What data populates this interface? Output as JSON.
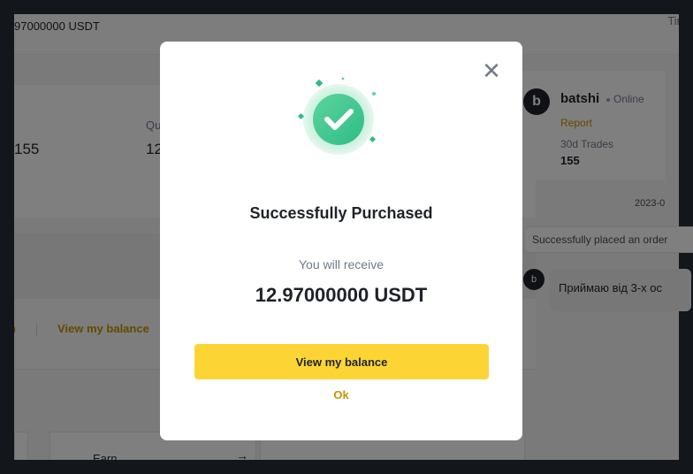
{
  "background": {
    "topbar": {
      "amount": "97000000 USDT",
      "time_label": "Tir"
    },
    "stats": {
      "value_left": "155",
      "quantity_label": "Qu",
      "quantity_value": "12"
    },
    "links": {
      "left_link": "n",
      "view_balance": "View my balance"
    },
    "earn": {
      "label": "Earn",
      "arrow": "→"
    },
    "profile": {
      "avatar_letter": "b",
      "name": "batshi",
      "status": "Online",
      "report": "Report",
      "trades_label": "30d Trades",
      "trades_value": "155"
    },
    "chat": {
      "date": "2023-0",
      "system_message": "Successfully placed an order",
      "avatar_letter": "b",
      "message": "Приймаю від 3-х ос"
    }
  },
  "modal": {
    "title": "Successfully Purchased",
    "receive_label": "You will receive",
    "receive_amount": "12.97000000 USDT",
    "primary_button": "View my balance",
    "secondary_link": "Ok",
    "close_glyph": "✕"
  },
  "colors": {
    "accent_yellow": "#fcd535",
    "link_gold": "#c99400",
    "success_green": "#2ebd85"
  }
}
